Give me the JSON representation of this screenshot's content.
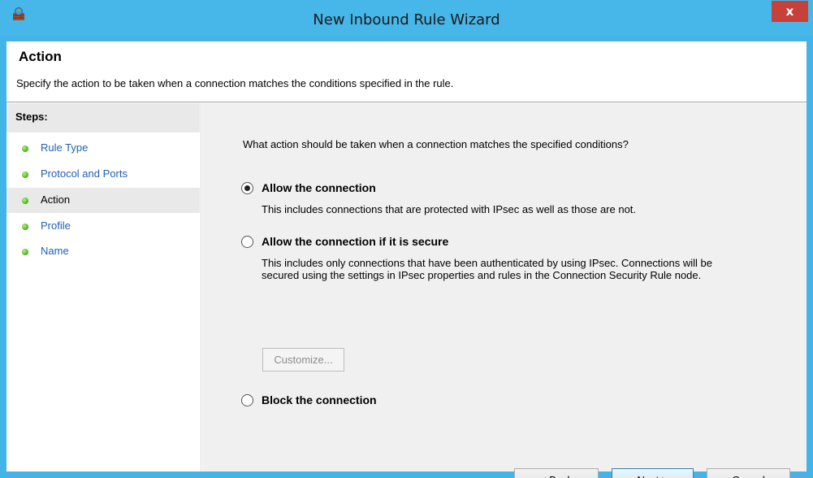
{
  "window": {
    "title": "New Inbound Rule Wizard",
    "close_label": "x",
    "accent_color": "#47b6e8"
  },
  "header": {
    "title": "Action",
    "description": "Specify the action to be taken when a connection matches the conditions specified in the rule."
  },
  "steps": {
    "title": "Steps:",
    "items": [
      {
        "label": "Rule Type",
        "current": false
      },
      {
        "label": "Protocol and Ports",
        "current": false
      },
      {
        "label": "Action",
        "current": true
      },
      {
        "label": "Profile",
        "current": false
      },
      {
        "label": "Name",
        "current": false
      }
    ]
  },
  "main": {
    "question": "What action should be taken when a connection matches the specified conditions?",
    "options": [
      {
        "label": "Allow the connection",
        "description": "This includes connections that are protected with IPsec as well as those are not.",
        "selected": true
      },
      {
        "label": "Allow the connection if it is secure",
        "description": "This includes only connections that have been authenticated by using IPsec.  Connections will be secured using the settings in IPsec properties and rules in the Connection Security Rule node.",
        "selected": false
      },
      {
        "label": "Block the connection",
        "description": "",
        "selected": false
      }
    ],
    "customize_label": "Customize..."
  },
  "buttons": {
    "back": "< Back",
    "next": "Next >",
    "cancel": "Cancel"
  }
}
